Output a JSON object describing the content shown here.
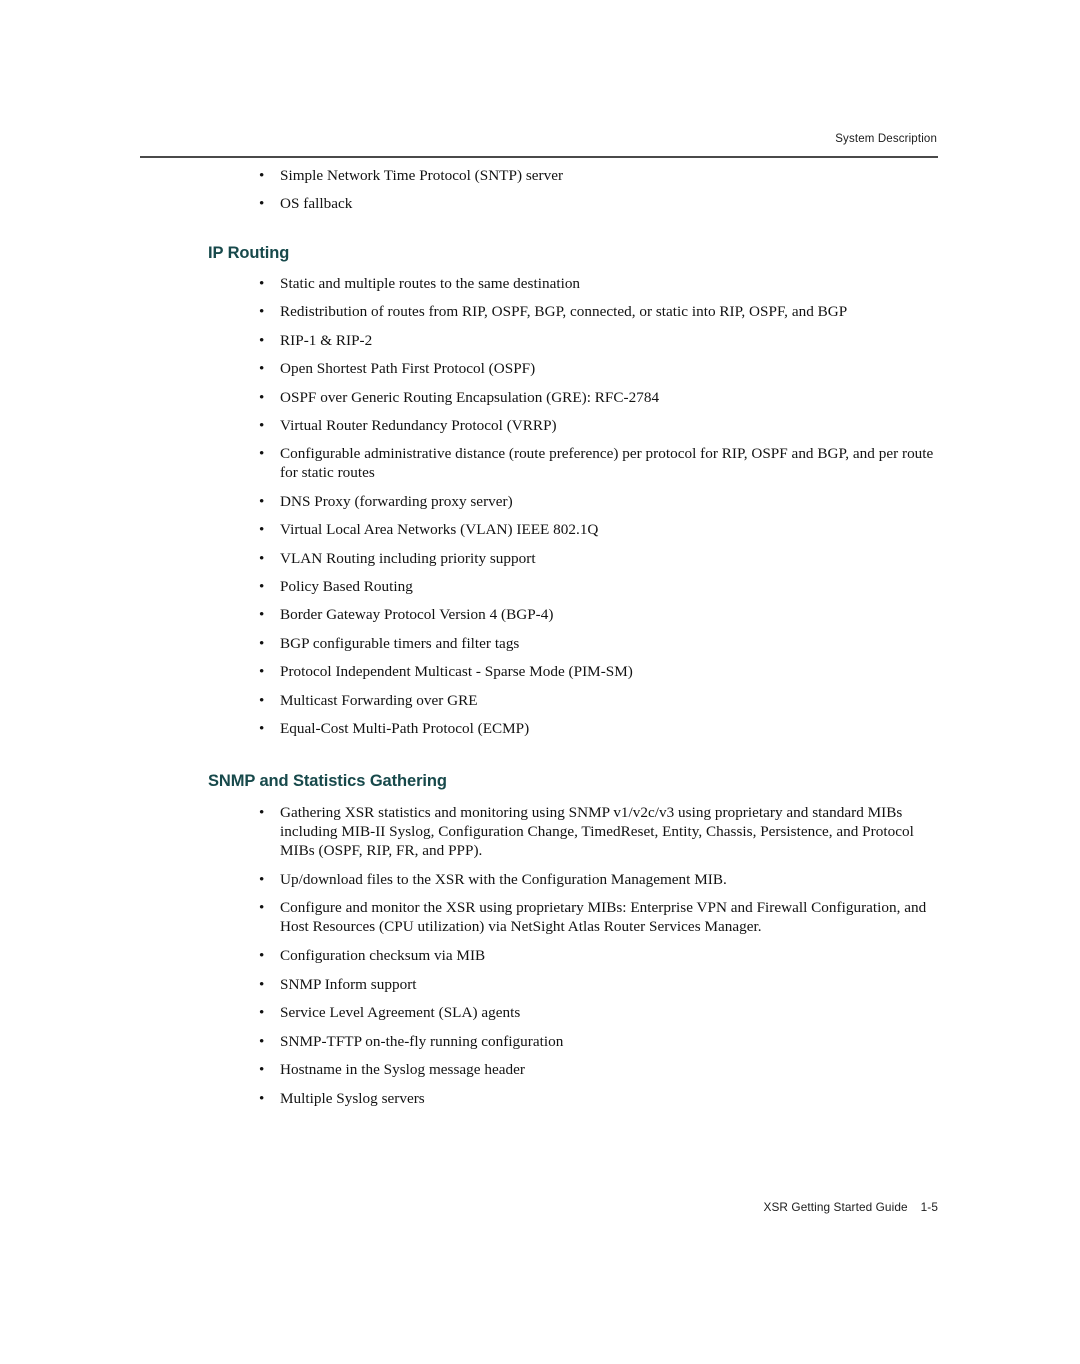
{
  "colors": {
    "heading_teal": "#17494b",
    "body_text": "#121212",
    "rule": "#4a4a4a",
    "page_background": "#ffffff"
  },
  "header": {
    "title": "System Description"
  },
  "footer": {
    "guide_title": "XSR Getting Started Guide",
    "page_number": "1-5"
  },
  "bullet_glyph": "•",
  "intro_list": {
    "items": [
      "Simple Network Time Protocol (SNTP) server",
      "OS fallback"
    ]
  },
  "sections": [
    {
      "heading": "IP Routing",
      "items": [
        "Static and multiple routes to the same destination",
        "Redistribution of routes from RIP, OSPF, BGP, connected, or static into RIP, OSPF, and BGP",
        "RIP-1 & RIP-2",
        "Open Shortest Path First Protocol (OSPF)",
        "OSPF over Generic Routing Encapsulation (GRE): RFC-2784",
        "Virtual Router Redundancy Protocol (VRRP)",
        "Configurable administrative distance (route preference) per protocol for RIP, OSPF and BGP, and per route for static routes",
        "DNS Proxy (forwarding proxy server)",
        "Virtual Local Area Networks (VLAN) IEEE 802.1Q",
        "VLAN Routing including priority support",
        "Policy Based Routing",
        "Border Gateway Protocol Version 4 (BGP-4)",
        "BGP configurable timers and filter tags",
        "Protocol Independent Multicast - Sparse Mode (PIM-SM)",
        "Multicast Forwarding over GRE",
        "Equal-Cost Multi-Path Protocol (ECMP)"
      ]
    },
    {
      "heading": "SNMP and Statistics Gathering",
      "items": [
        "Gathering XSR statistics and monitoring using SNMP v1/v2c/v3 using proprietary and standard MIBs including MIB-II Syslog, Configuration Change, TimedReset, Entity, Chassis, Persistence, and Protocol MIBs (OSPF, RIP, FR, and PPP).",
        "Up/download files to the XSR with the Configuration Management MIB.",
        "Configure and monitor the XSR using proprietary MIBs: Enterprise VPN and Firewall Configuration, and Host Resources (CPU utilization) via NetSight Atlas Router Services Manager.",
        "Configuration checksum via MIB",
        "SNMP Inform support",
        "Service Level Agreement (SLA) agents",
        "SNMP-TFTP on-the-fly running configuration",
        "Hostname in the Syslog message header",
        "Multiple Syslog servers"
      ]
    }
  ]
}
